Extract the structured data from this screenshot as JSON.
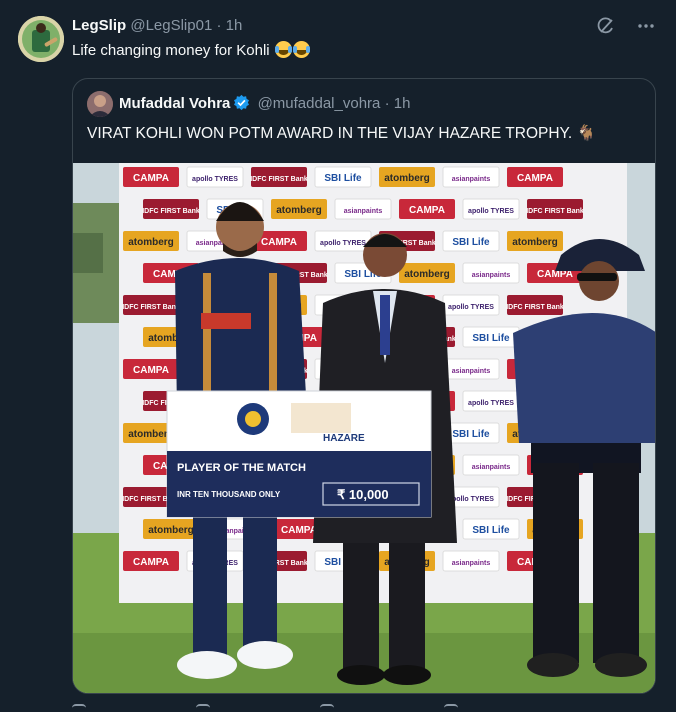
{
  "tweet": {
    "author_name": "LegSlip",
    "author_handle": "@LegSlip01",
    "separator": "·",
    "time": "1h",
    "text": "Life changing money for Kohli"
  },
  "quoted_tweet": {
    "author_name": "Mufaddal Vohra",
    "author_handle": "@mufaddal_vohra",
    "separator": "·",
    "time": "1h",
    "text": "VIRAT KOHLI WON POTM AWARD IN THE VIJAY HAZARE TROPHY. 🐐"
  },
  "media": {
    "cheque_tournament": "HAZARE",
    "cheque_title": "PLAYER OF THE MATCH",
    "cheque_amount_words": "INR TEN THOUSAND ONLY",
    "cheque_amount": "₹ 10,000",
    "backdrop_brands": [
      "CAMPA",
      "apollo TYRES",
      "IDFC FIRST Bank",
      "SBI Life",
      "atomberg",
      "asianpaints"
    ]
  },
  "colors": {
    "background": "#15202b",
    "text": "#f7f9f9",
    "secondary_text": "#8b98a5",
    "border": "#38444d",
    "verified_badge": "#1d9bf0"
  },
  "icons": [
    "grok-icon",
    "more-icon",
    "verified-badge-icon",
    "emoji-joy-icon",
    "goat-emoji-icon"
  ]
}
